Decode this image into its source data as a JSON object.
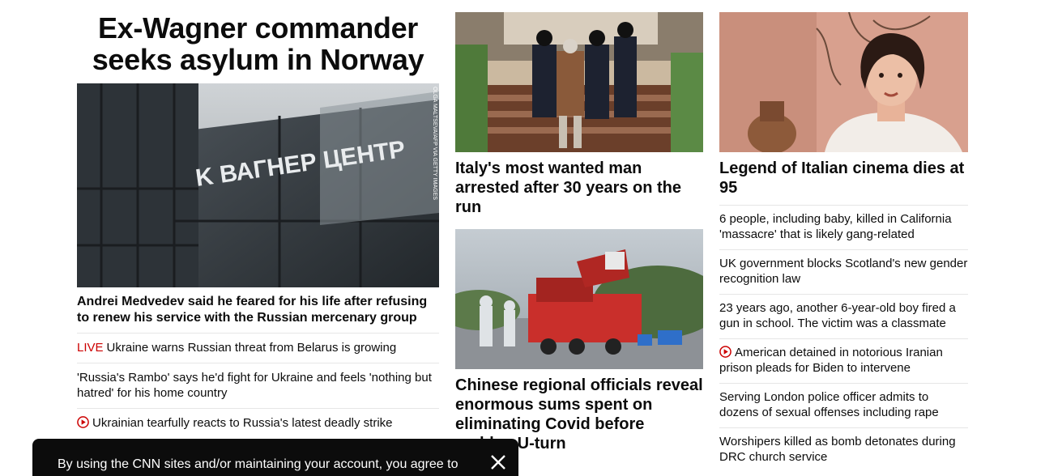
{
  "lead": {
    "headline": "Ex-Wagner commander seeks asylum in Norway",
    "image_alt": "Wagner Center building",
    "image_sign": "K ВАГНЕР ЦЕНТР",
    "image_credit": "OLGA MALTSEVA/AFP VIA GETTY IMAGES",
    "caption": "Andrei Medvedev said he feared for his life after refusing to renew his service with the Russian mercenary group",
    "related": [
      {
        "live": "LIVE",
        "text": "Ukraine warns Russian threat from Belarus is growing"
      },
      {
        "text": "'Russia's Rambo' says he'd fight for Ukraine and feels 'nothing but hatred' for his home country"
      },
      {
        "video": true,
        "text": "Ukrainian tearfully reacts to Russia's latest deadly strike"
      }
    ]
  },
  "middle": {
    "story1": {
      "headline": "Italy's most wanted man arrested after 30 years on the run"
    },
    "story2": {
      "headline": "Chinese regional officials reveal enormous sums spent on eliminating Covid before sudden U-turn"
    }
  },
  "right": {
    "headline": "Legend of Italian cinema dies at 95",
    "list": [
      {
        "text": "6 people, including baby, killed in California 'massacre' that is likely gang-related"
      },
      {
        "text": "UK government blocks Scotland's new gender recognition law"
      },
      {
        "text": "23 years ago, another 6-year-old boy fired a gun in school. The victim was a classmate"
      },
      {
        "video": true,
        "text": "American detained in notorious Iranian prison pleads for Biden to intervene"
      },
      {
        "text": "Serving London police officer admits to dozens of sexual offenses including rape"
      },
      {
        "text": "Worshipers killed as bomb detonates during DRC church service"
      }
    ]
  },
  "cookie": {
    "text": "By using the CNN sites and/or maintaining your account, you agree to"
  },
  "colors": {
    "live": "#cc0000",
    "text": "#0c0c0c",
    "divider": "#e6e6e6",
    "cookie_bg": "#0c0c0c"
  }
}
